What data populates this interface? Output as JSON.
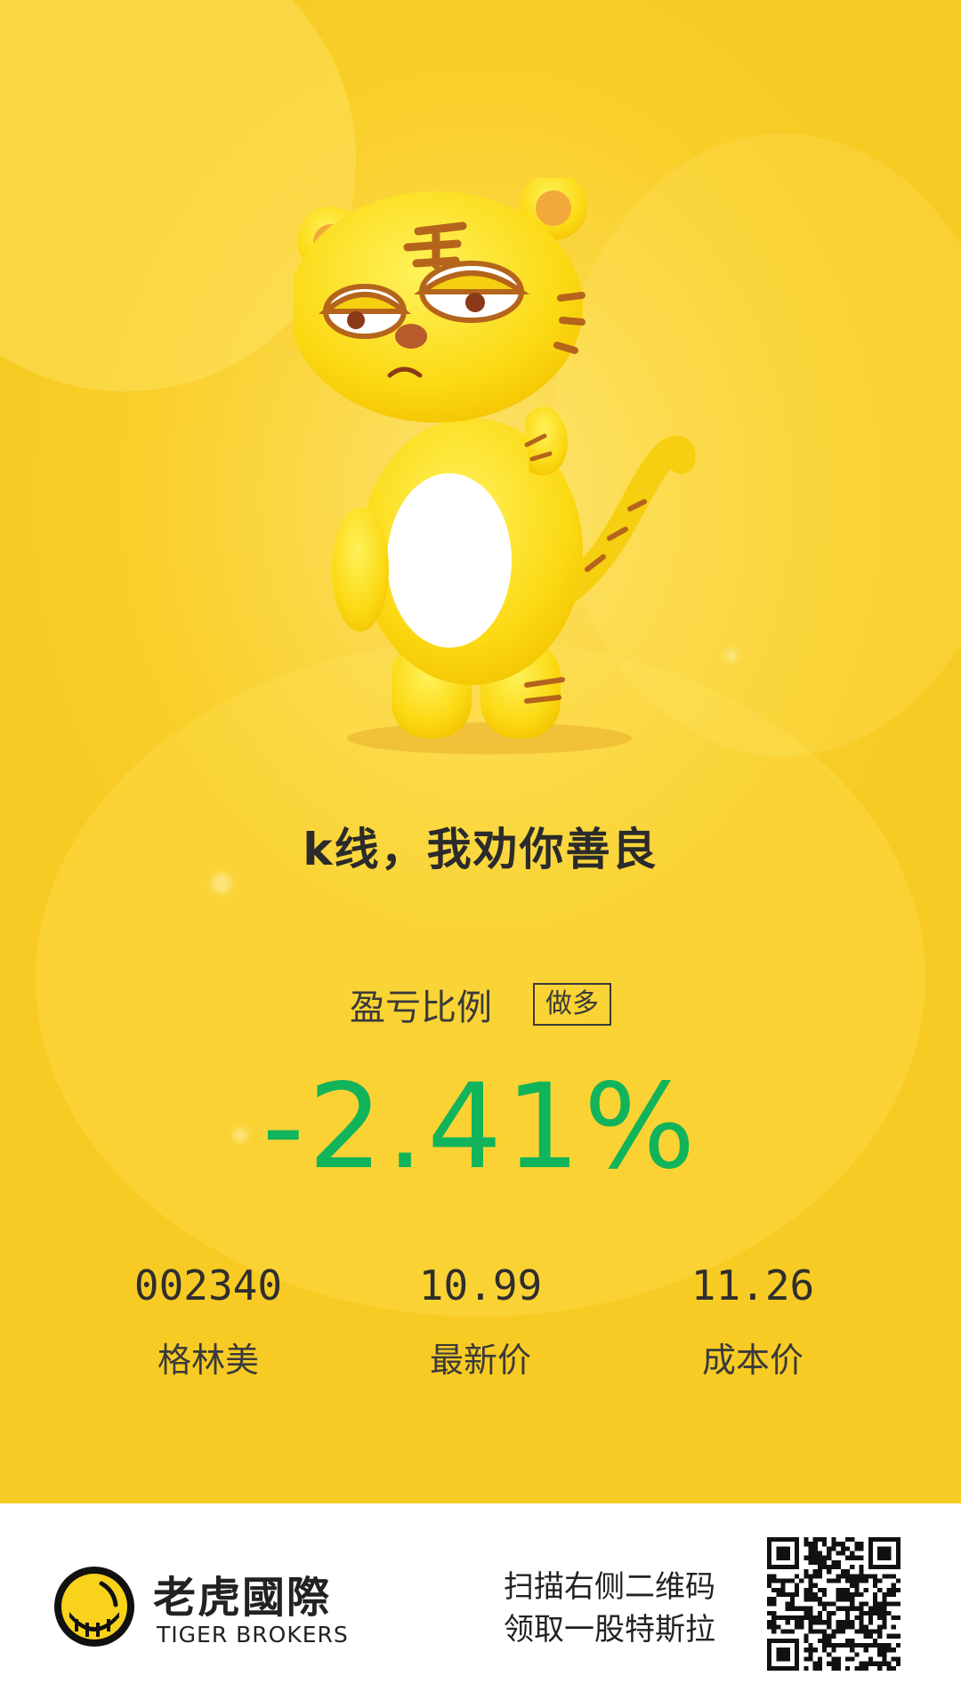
{
  "poster": {
    "slogan": "k线，我劝你善良",
    "ratio_label": "盈亏比例",
    "position_side": "做多",
    "pnl_percent": "-2.41%",
    "colors": {
      "background": "#f9cf2a",
      "loss_green": "#11b45a",
      "text_dark": "#2b2b2b"
    }
  },
  "stats": [
    {
      "value": "002340",
      "label": "格林美"
    },
    {
      "value": "10.99",
      "label": "最新价"
    },
    {
      "value": "11.26",
      "label": "成本价"
    }
  ],
  "footer": {
    "brand_cn": "老虎國際",
    "brand_en": "TIGER BROKERS",
    "promo_line1": "扫描右侧二维码",
    "promo_line2": "领取一股特斯拉",
    "logo_icon": "tiger-logo-icon",
    "qr_icon": "qr-code-icon"
  }
}
